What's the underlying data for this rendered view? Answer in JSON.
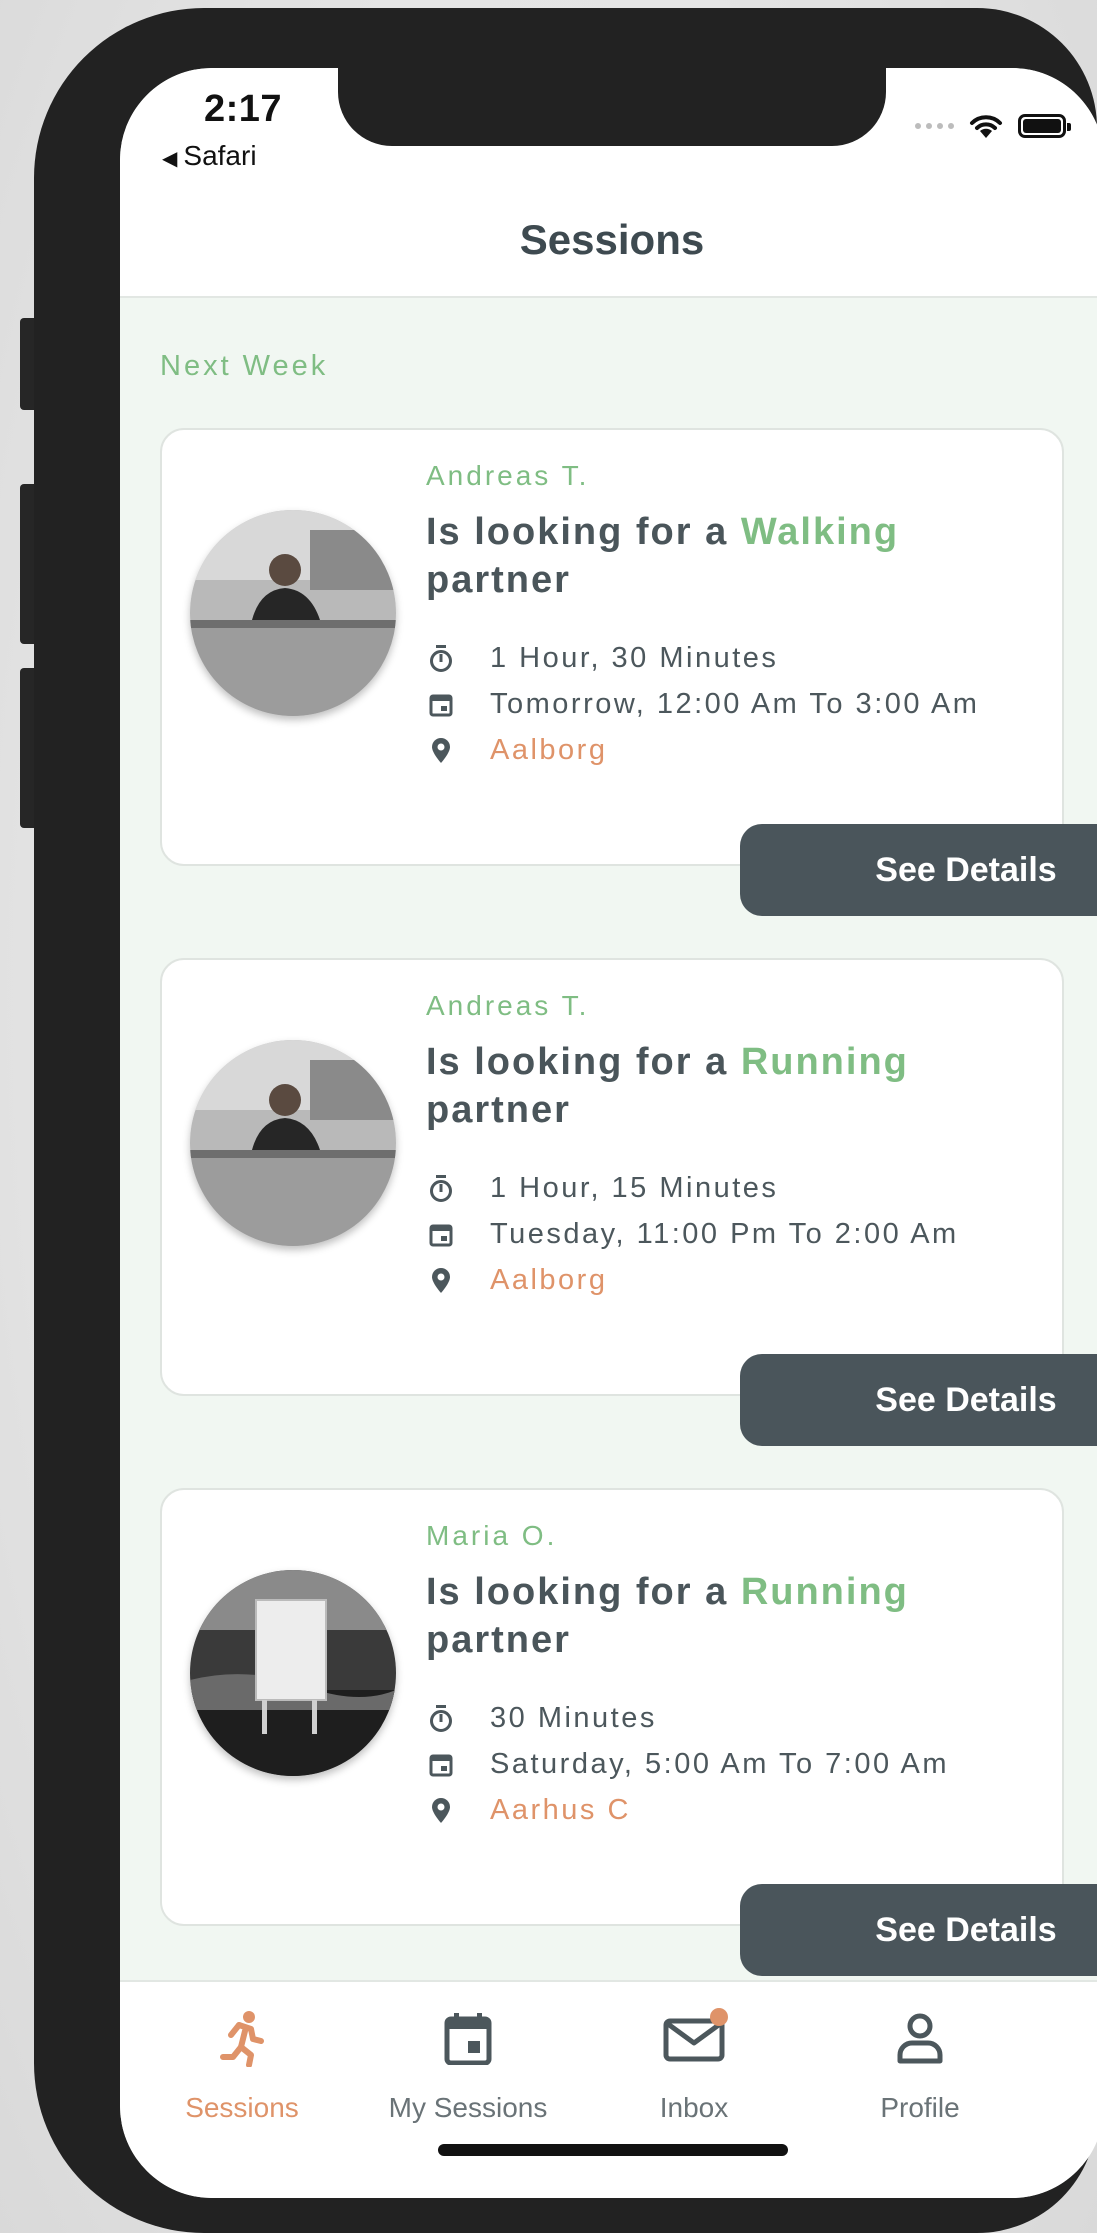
{
  "status_bar": {
    "time": "2:17",
    "back_app": "Safari"
  },
  "header": {
    "title": "Sessions"
  },
  "section": {
    "label": "Next Week"
  },
  "sessions": [
    {
      "user": "Andreas T.",
      "headline_prefix": "Is looking for a",
      "activity": "Walking",
      "headline_suffix": "partner",
      "duration": "1 Hour, 30 Minutes",
      "schedule": "Tomorrow, 12:00 Am To 3:00 Am",
      "location": "Aalborg",
      "button": "See Details"
    },
    {
      "user": "Andreas T.",
      "headline_prefix": "Is looking for a",
      "activity": "Running",
      "headline_suffix": "partner",
      "duration": "1 Hour, 15 Minutes",
      "schedule": "Tuesday, 11:00 Pm To 2:00 Am",
      "location": "Aalborg",
      "button": "See Details"
    },
    {
      "user": "Maria O.",
      "headline_prefix": "Is looking for a",
      "activity": "Running",
      "headline_suffix": "partner",
      "duration": "30 Minutes",
      "schedule": "Saturday, 5:00 Am To 7:00 Am",
      "location": "Aarhus C",
      "button": "See Details"
    }
  ],
  "tabs": [
    {
      "label": "Sessions",
      "icon": "running-person-icon",
      "active": true
    },
    {
      "label": "My Sessions",
      "icon": "calendar-icon",
      "active": false
    },
    {
      "label": "Inbox",
      "icon": "mail-icon",
      "active": false,
      "badge": true
    },
    {
      "label": "Profile",
      "icon": "person-icon",
      "active": false
    }
  ],
  "colors": {
    "accent_green": "#7fbd83",
    "accent_orange": "#df9369",
    "button_dark": "#4a555b",
    "text_dark": "#4a555a",
    "background": "#f1f7f2"
  }
}
